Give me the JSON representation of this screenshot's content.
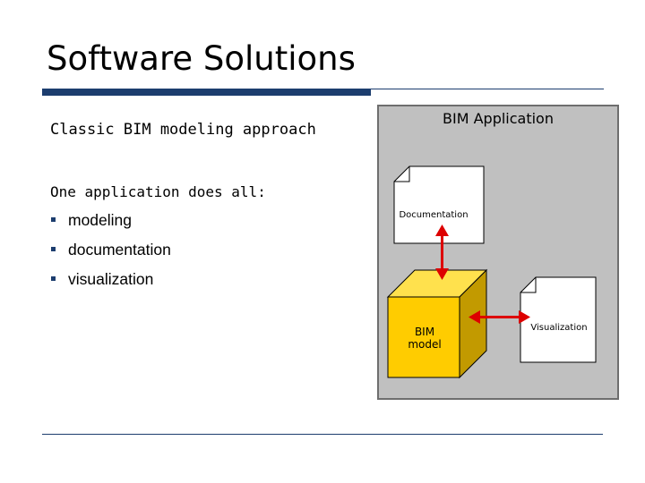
{
  "slide": {
    "title": "Software Solutions",
    "subtitle": "Classic BIM modeling approach",
    "intro": "One application does all:",
    "bullets": [
      "modeling",
      "documentation",
      "visualization"
    ]
  },
  "diagram": {
    "app_label": "BIM Application",
    "documentation_label": "Documentation",
    "model_label_line1": "BIM",
    "model_label_line2": "model",
    "visualization_label": "Visualization",
    "colors": {
      "app_box": "#c0c0c0",
      "model_cube": "#ffcc00",
      "arrow": "#dd0000",
      "rule": "#1c3d6e"
    }
  }
}
